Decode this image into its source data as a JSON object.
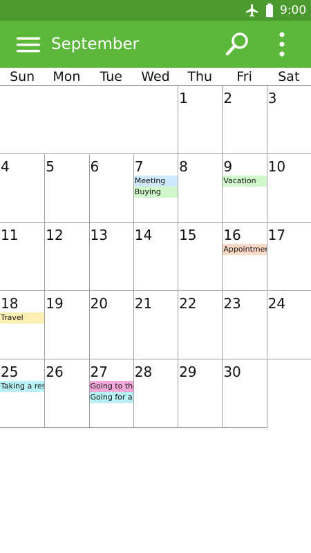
{
  "status_bar": {
    "time": "9:00",
    "icons": [
      "airplane-icon",
      "battery-icon"
    ]
  },
  "app_bar": {
    "title": "September",
    "icons": [
      "menu-icon",
      "search-icon",
      "more-vert-icon"
    ]
  },
  "colors": {
    "status_bar": "#4a9a2e",
    "app_bar": "#5cb83a",
    "grid_line": "#9e9e9e",
    "event_blue": "#cfe8fb",
    "event_green": "#d1f7cc",
    "event_orange": "#fcd8c6",
    "event_yellow": "#fdefb4",
    "event_cyan": "#b8f3f8",
    "event_pink": "#f5a8d9"
  },
  "weekdays": [
    "Sun",
    "Mon",
    "Tue",
    "Wed",
    "Thu",
    "Fri",
    "Sat"
  ],
  "weeks": [
    [
      {
        "day": ""
      },
      {
        "day": ""
      },
      {
        "day": ""
      },
      {
        "day": ""
      },
      {
        "day": "1",
        "events": []
      },
      {
        "day": "2",
        "events": []
      },
      {
        "day": "3",
        "events": []
      }
    ],
    [
      {
        "day": "4",
        "events": []
      },
      {
        "day": "5",
        "events": []
      },
      {
        "day": "6",
        "events": []
      },
      {
        "day": "7",
        "events": [
          {
            "title": "Meeting",
            "color": "#cfe8fb"
          },
          {
            "title": "Buying",
            "color": "#d1f7cc"
          }
        ]
      },
      {
        "day": "8",
        "events": []
      },
      {
        "day": "9",
        "events": [
          {
            "title": "Vacation",
            "color": "#d1f7cc"
          }
        ]
      },
      {
        "day": "10",
        "events": []
      }
    ],
    [
      {
        "day": "11",
        "events": []
      },
      {
        "day": "12",
        "events": []
      },
      {
        "day": "13",
        "events": []
      },
      {
        "day": "14",
        "events": []
      },
      {
        "day": "15",
        "events": []
      },
      {
        "day": "16",
        "events": [
          {
            "title": "Appointmen",
            "color": "#fcd8c6"
          }
        ]
      },
      {
        "day": "17",
        "events": []
      }
    ],
    [
      {
        "day": "18",
        "events": [
          {
            "title": "Travel",
            "color": "#fdefb4"
          }
        ]
      },
      {
        "day": "19",
        "events": []
      },
      {
        "day": "20",
        "events": []
      },
      {
        "day": "21",
        "events": []
      },
      {
        "day": "22",
        "events": []
      },
      {
        "day": "23",
        "events": []
      },
      {
        "day": "24",
        "events": []
      }
    ],
    [
      {
        "day": "25",
        "events": [
          {
            "title": "Taking a rest",
            "color": "#b8f3f8"
          }
        ]
      },
      {
        "day": "26",
        "events": []
      },
      {
        "day": "27",
        "events": [
          {
            "title": "Going to the",
            "color": "#f5a8d9"
          },
          {
            "title": "Going for a",
            "color": "#b8f3f8"
          }
        ]
      },
      {
        "day": "28",
        "events": []
      },
      {
        "day": "29",
        "events": []
      },
      {
        "day": "30",
        "events": []
      },
      {
        "day": ""
      }
    ]
  ]
}
